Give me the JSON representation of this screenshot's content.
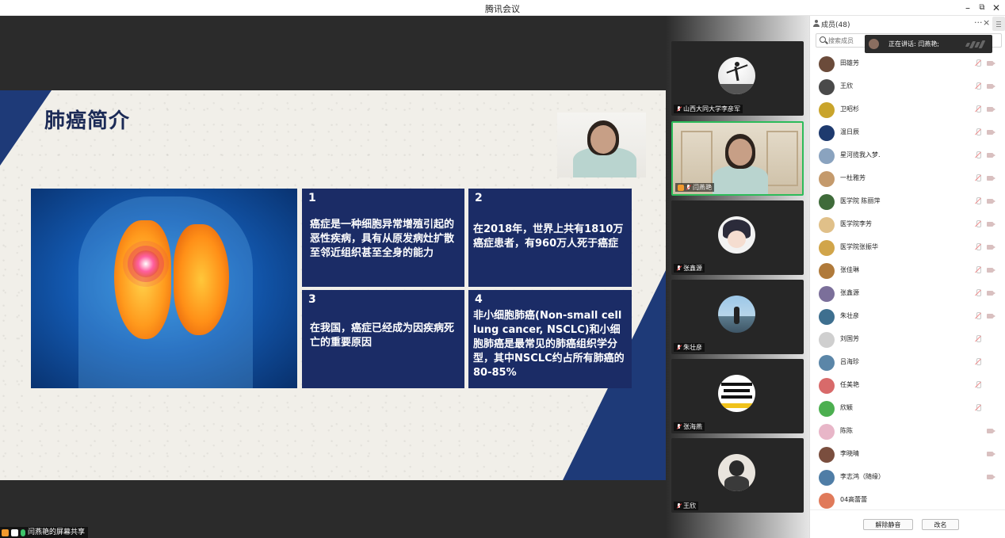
{
  "window": {
    "title": "腾讯会议"
  },
  "slide": {
    "title": "肺癌简介",
    "cards": [
      {
        "num": "1",
        "text": "癌症是一种细胞异常增殖引起的恶性疾病，具有从原发病灶扩散至邻近组织甚至全身的能力"
      },
      {
        "num": "2",
        "text": "在2018年，世界上共有1810万癌症患者，有960万人死于癌症"
      },
      {
        "num": "3",
        "text": "在我国，癌症已经成为因疾病死亡的重要原因"
      },
      {
        "num": "4",
        "text": "非小细胞肺癌(Non-small cell lung cancer, NSCLC)和小细胞肺癌是最常见的肺癌组织学分型，其中NSCLC约占所有肺癌的80-85%"
      }
    ]
  },
  "share_label": "闫燕艳的屏幕共享",
  "video_tiles": [
    {
      "name": "山西大同大学李彦军"
    },
    {
      "name": "闫燕艳"
    },
    {
      "name": "张鑫源"
    },
    {
      "name": "朱壮彦"
    },
    {
      "name": "张海燕"
    },
    {
      "name": "王欣"
    }
  ],
  "members_panel": {
    "title": "成员(48)",
    "more": "···",
    "close": "×",
    "search_placeholder": "搜索成员",
    "speaking_label": "正在讲话: 闫燕艳;",
    "members": [
      {
        "name": "田雄芳",
        "color": "#6b4b3a"
      },
      {
        "name": "王欣",
        "color": "#4a4a4a"
      },
      {
        "name": "卫昭杉",
        "color": "#c9a42b"
      },
      {
        "name": "温日辰",
        "color": "#1e3a6e"
      },
      {
        "name": "星河揽我入梦.",
        "color": "#8aa3bf"
      },
      {
        "name": "一杜雅芳",
        "color": "#c49a6c"
      },
      {
        "name": "医学院  陈丽萍",
        "color": "#3f6b3a"
      },
      {
        "name": "医学院李芳",
        "color": "#e0c089"
      },
      {
        "name": "医学院张振华",
        "color": "#d1a54a"
      },
      {
        "name": "张佳琳",
        "color": "#b07a3a"
      },
      {
        "name": "张鑫源",
        "color": "#7b6f9a"
      },
      {
        "name": "朱壮彦",
        "color": "#3e6f8f"
      },
      {
        "name": "刘国芳",
        "color": "#cfcfcf"
      },
      {
        "name": "吕海珍",
        "color": "#5b86a8"
      },
      {
        "name": "任美艳",
        "color": "#d86a6a"
      },
      {
        "name": "欣颖",
        "color": "#4caf50"
      },
      {
        "name": "陈陈",
        "color": "#e8b6c8"
      },
      {
        "name": "李晓晴",
        "color": "#7a4e3e"
      },
      {
        "name": "李志鸿（随缘）",
        "color": "#4f7da6"
      },
      {
        "name": "04高蕾蕾",
        "color": "#e07a5a"
      }
    ],
    "unmute_all": "解除静音",
    "rename": "改名"
  }
}
